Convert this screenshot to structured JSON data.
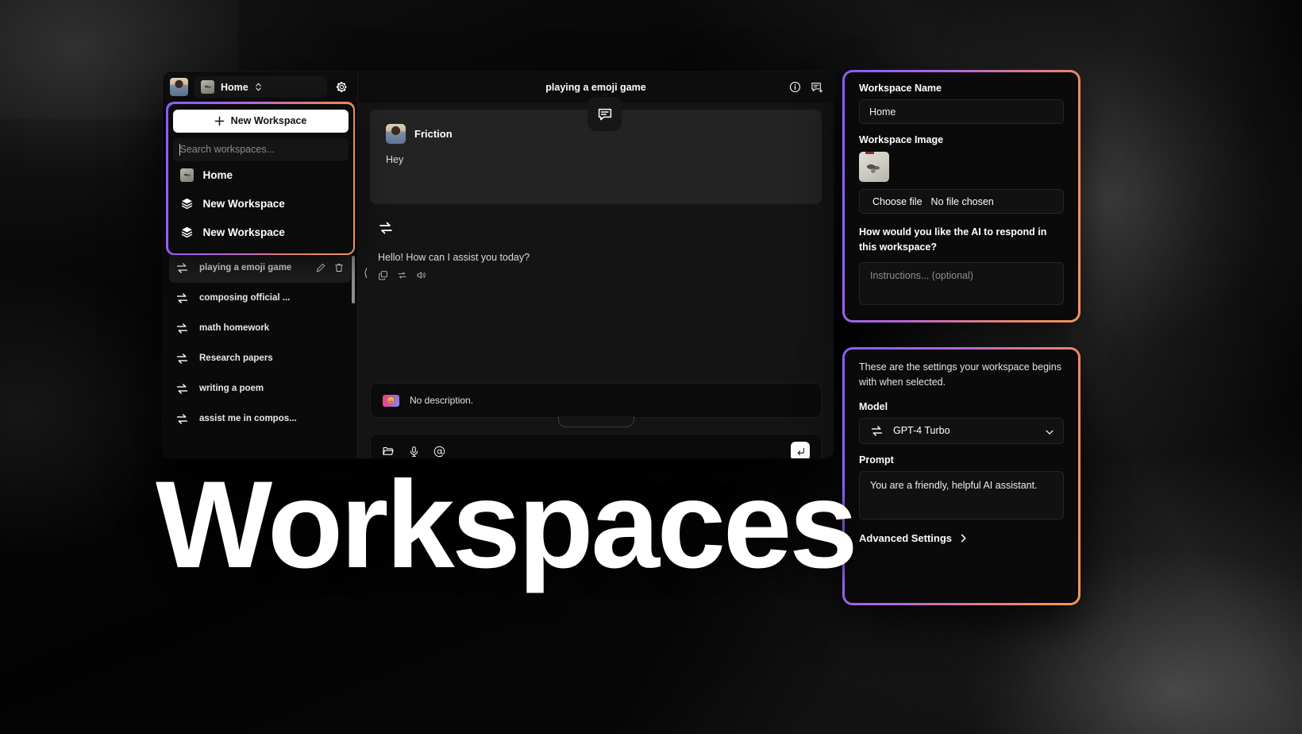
{
  "hero": {
    "title": "Workspaces"
  },
  "sidebar": {
    "workspace_pill": {
      "name": "Home",
      "icon": "workspace-thumb",
      "chevron": "chevron-up-down-icon"
    },
    "settings_icon": "gear-icon",
    "avatar": "user-avatar",
    "dropdown": {
      "new_workspace_label": "New Workspace",
      "new_workspace_icon": "plus-icon",
      "search_placeholder": "Search workspaces...",
      "items": [
        {
          "label": "Home",
          "icon": "workspace-thumb"
        },
        {
          "label": "New Workspace",
          "icon": "layers-icon"
        },
        {
          "label": "New Workspace",
          "icon": "layers-icon"
        }
      ]
    },
    "chats": [
      {
        "label": "playing a emoji game",
        "icon": "swap-icon",
        "active": true,
        "edit_icon": "edit-icon",
        "delete_icon": "trash-icon"
      },
      {
        "label": "composing official ...",
        "icon": "swap-icon",
        "active": false
      },
      {
        "label": "math homework",
        "icon": "swap-icon",
        "active": false
      },
      {
        "label": "Research papers",
        "icon": "swap-icon",
        "active": false
      },
      {
        "label": "writing a poem",
        "icon": "swap-icon",
        "active": false
      },
      {
        "label": "assist me in compos...",
        "icon": "swap-icon",
        "active": false
      }
    ]
  },
  "main": {
    "title": "playing a emoji game",
    "info_icon": "info-circle-icon",
    "new_chat_icon": "new-chat-icon",
    "bubble_badge_icon": "chat-bubble-icon",
    "user_message": {
      "name": "Friction",
      "text": "Hey",
      "avatar": "user-avatar"
    },
    "ai_message": {
      "icon": "swap-icon",
      "text": "Hello! How can I assist you today?",
      "actions": [
        {
          "name": "copy-icon"
        },
        {
          "name": "regenerate-icon"
        },
        {
          "name": "speak-icon"
        }
      ]
    },
    "description": {
      "text": "No description.",
      "icon": "gradient-thumb"
    },
    "composer": {
      "attach_icon": "folder-icon",
      "mic_icon": "microphone-icon",
      "mention_icon": "at-icon",
      "send_icon": "enter-arrow-icon"
    },
    "help_label": "?"
  },
  "settings_panel": {
    "name_label": "Workspace Name",
    "name_value": "Home",
    "image_label": "Workspace Image",
    "image_thumb": "workspace-image-thumb",
    "choose_file_label": "Choose file",
    "file_status": "No file chosen",
    "instructions_question": "How would you like the AI to respond in this workspace?",
    "instructions_placeholder": "Instructions... (optional)"
  },
  "model_panel": {
    "blurb": "These are the settings your workspace begins with when selected.",
    "model_label": "Model",
    "model_value": "GPT-4 Turbo",
    "model_icon": "swap-icon",
    "model_chevron": "chevron-down-icon",
    "prompt_label": "Prompt",
    "prompt_value": "You are a friendly, helpful AI assistant.",
    "advanced_label": "Advanced Settings",
    "advanced_chevron": "chevron-right-icon"
  },
  "colors": {
    "gradient_start": "#8b5cf6",
    "gradient_end": "#f2975c",
    "window_bg": "#0b0b0b",
    "panel_bg": "#0a0a0a",
    "chat_bg": "#141414"
  }
}
